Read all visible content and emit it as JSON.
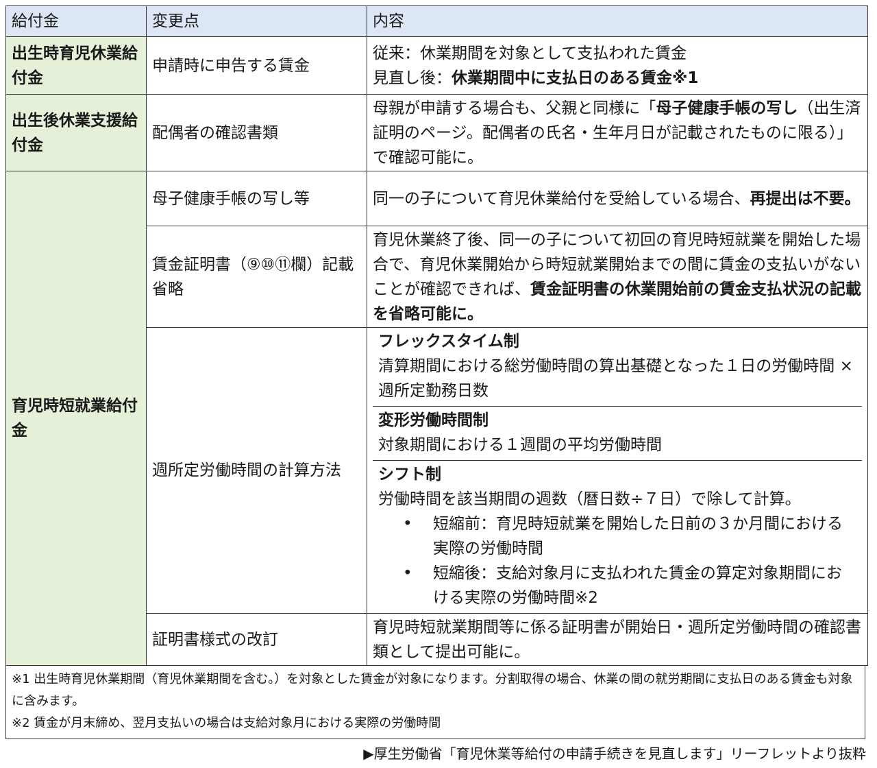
{
  "headers": {
    "benefit": "給付金",
    "change": "変更点",
    "content": "内容"
  },
  "row1": {
    "benefit": "出生時育児休業給付金",
    "change": "申請時に申告する賃金",
    "line1": "従来：休業期間を対象として支払われた賃金",
    "line2_prefix": "見直し後：",
    "line2_bold": "休業期間中に支払日のある賃金※1"
  },
  "row2": {
    "benefit": "出生後休業支援給付金",
    "change": "配偶者の確認書類",
    "text_pre": "母親が申請する場合も、父親と同様に「",
    "text_bold": "母子健康手帳の写し",
    "text_post": "（出生済証明のページ。配偶者の氏名・生年月日が記載されたものに限る）」で確認可能に。"
  },
  "row3": {
    "benefit": "育児時短就業給付金",
    "a": {
      "change": "母子健康手帳の写し等",
      "text_pre": "同一の子について育児休業給付を受給している場合、",
      "text_bold": "再提出は不要。"
    },
    "b": {
      "change": "賃金証明書（⑨⑩⑪欄）記載省略",
      "text_pre": "育児休業終了後、同一の子について初回の育児時短就業を開始した場合で、育児休業開始から時短就業開始までの間に賃金の支払いがないことが確認できれば、",
      "text_bold": "賃金証明書の休業開始前の賃金支払状況の記載を省略可能に。"
    },
    "c": {
      "change": "週所定労働時間の計算方法",
      "flex_title": "フレックスタイム制",
      "flex_text": "清算期間における総労働時間の算出基礎となった１日の労働時間 × 週所定勤務日数",
      "hen_title": "変形労働時間制",
      "hen_text": "対象期間における１週間の平均労働時間",
      "shift_title": "シフト制",
      "shift_text": "労働時間を該当期間の週数（暦日数÷７日）で除して計算。",
      "bullets": [
        "短縮前：育児時短就業を開始した日前の３か月間における実際の労働時間",
        "短縮後：支給対象月に支払われた賃金の算定対象期間における実際の労働時間※2"
      ],
      "bullet_mark": "•"
    },
    "d": {
      "change": "証明書様式の改訂",
      "text": "育児時短就業期間等に係る証明書が開始日・週所定労働時間の確認書類として提出可能に。"
    }
  },
  "notes": [
    "※1 出生時育児休業期間（育児休業期間を含む。）を対象とした賃金が対象になります。分割取得の場合、休業の間の就労期間に支払日のある賃金も対象に含みます。",
    "※2 賃金が月末締め、翌月支払いの場合は支給対象月における実際の労働時間"
  ],
  "source": "▶厚生労働省「育児休業等給付の申請手続きを見直します」リーフレットより抜粋"
}
